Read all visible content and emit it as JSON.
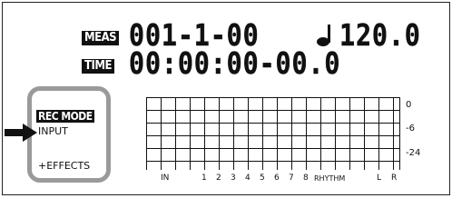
{
  "display": {
    "meas_tag": "MEAS",
    "meas_value": "001-1-00",
    "tempo_value": "120.0",
    "time_tag": "TIME",
    "time_value": "00:00:00-00.0",
    "rec_mode": {
      "title": "REC MODE",
      "option_input": "INPUT",
      "option_effects": "+EFFECTS",
      "selected": "INPUT"
    },
    "meter": {
      "db_labels": [
        "0",
        "-6",
        "-24"
      ],
      "channels": [
        "IN",
        "1",
        "2",
        "3",
        "4",
        "5",
        "6",
        "7",
        "8",
        "RHYTHM",
        "L",
        "R"
      ]
    }
  }
}
